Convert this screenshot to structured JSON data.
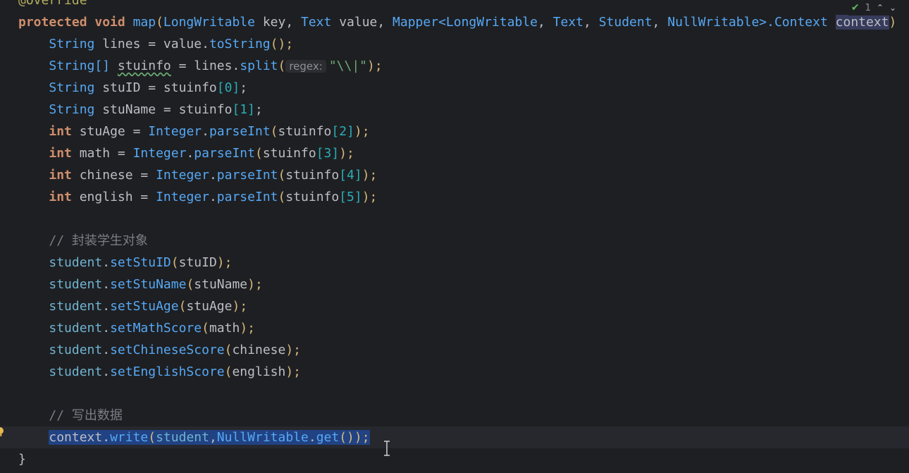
{
  "editor": {
    "status": {
      "problems_count": "1"
    },
    "lines": [
      [
        {
          "t": "@Override",
          "c": "ann"
        }
      ],
      [
        {
          "t": "protected ",
          "c": "kw"
        },
        {
          "t": "void ",
          "c": "kw"
        },
        {
          "t": "map",
          "c": "fn"
        },
        {
          "t": "(",
          "c": "paren"
        },
        {
          "t": "LongWritable ",
          "c": "type"
        },
        {
          "t": "key, ",
          "c": "punct"
        },
        {
          "t": "Text ",
          "c": "type"
        },
        {
          "t": "value, ",
          "c": "punct"
        },
        {
          "t": "Mapper<",
          "c": "type"
        },
        {
          "t": "LongWritable",
          "c": "type"
        },
        {
          "t": ", ",
          "c": "punct"
        },
        {
          "t": "Text",
          "c": "type"
        },
        {
          "t": ", ",
          "c": "punct"
        },
        {
          "t": "Student",
          "c": "type"
        },
        {
          "t": ", ",
          "c": "punct"
        },
        {
          "t": "NullWritable",
          "c": "type"
        },
        {
          "t": ">.Context ",
          "c": "type"
        },
        {
          "t": "context",
          "c": "punct ctxbox"
        },
        {
          "t": ")",
          "c": "paren"
        }
      ],
      [
        {
          "t": "    "
        },
        {
          "t": "String ",
          "c": "type"
        },
        {
          "t": "lines = value.",
          "c": "punct"
        },
        {
          "t": "toString",
          "c": "fn"
        },
        {
          "t": "();",
          "c": "paren"
        }
      ],
      [
        {
          "t": "    "
        },
        {
          "t": "String[] ",
          "c": "type"
        },
        {
          "t": "stuinfo",
          "c": "punct squiggle"
        },
        {
          "t": " = lines.",
          "c": "punct"
        },
        {
          "t": "split",
          "c": "fn"
        },
        {
          "t": "(",
          "c": "paren"
        },
        {
          "t": "regex:",
          "c": "hint"
        },
        {
          "t": "\"\\\\|\"",
          "c": "str"
        },
        {
          "t": ");",
          "c": "paren"
        }
      ],
      [
        {
          "t": "    "
        },
        {
          "t": "String ",
          "c": "type"
        },
        {
          "t": "stuID = stuinfo",
          "c": "punct"
        },
        {
          "t": "[0]",
          "c": "num"
        },
        {
          "t": ";",
          "c": "punct"
        }
      ],
      [
        {
          "t": "    "
        },
        {
          "t": "String ",
          "c": "type"
        },
        {
          "t": "stuName = stuinfo",
          "c": "punct"
        },
        {
          "t": "[1]",
          "c": "num"
        },
        {
          "t": ";",
          "c": "punct"
        }
      ],
      [
        {
          "t": "    "
        },
        {
          "t": "int ",
          "c": "kw"
        },
        {
          "t": "stuAge = ",
          "c": "punct"
        },
        {
          "t": "Integer",
          "c": "type"
        },
        {
          "t": ".",
          "c": "punct"
        },
        {
          "t": "parseInt",
          "c": "fn"
        },
        {
          "t": "(",
          "c": "paren"
        },
        {
          "t": "stuinfo",
          "c": "punct"
        },
        {
          "t": "[2]",
          "c": "num"
        },
        {
          "t": ");",
          "c": "paren"
        }
      ],
      [
        {
          "t": "    "
        },
        {
          "t": "int ",
          "c": "kw"
        },
        {
          "t": "math = ",
          "c": "punct"
        },
        {
          "t": "Integer",
          "c": "type"
        },
        {
          "t": ".",
          "c": "punct"
        },
        {
          "t": "parseInt",
          "c": "fn"
        },
        {
          "t": "(",
          "c": "paren"
        },
        {
          "t": "stuinfo",
          "c": "punct"
        },
        {
          "t": "[3]",
          "c": "num"
        },
        {
          "t": ");",
          "c": "paren"
        }
      ],
      [
        {
          "t": "    "
        },
        {
          "t": "int ",
          "c": "kw"
        },
        {
          "t": "chinese = ",
          "c": "punct"
        },
        {
          "t": "Integer",
          "c": "type"
        },
        {
          "t": ".",
          "c": "punct"
        },
        {
          "t": "parseInt",
          "c": "fn"
        },
        {
          "t": "(",
          "c": "paren"
        },
        {
          "t": "stuinfo",
          "c": "punct"
        },
        {
          "t": "[4]",
          "c": "num"
        },
        {
          "t": ");",
          "c": "paren"
        }
      ],
      [
        {
          "t": "    "
        },
        {
          "t": "int ",
          "c": "kw"
        },
        {
          "t": "english = ",
          "c": "punct"
        },
        {
          "t": "Integer",
          "c": "type"
        },
        {
          "t": ".",
          "c": "punct"
        },
        {
          "t": "parseInt",
          "c": "fn"
        },
        {
          "t": "(",
          "c": "paren"
        },
        {
          "t": "stuinfo",
          "c": "punct"
        },
        {
          "t": "[5]",
          "c": "num"
        },
        {
          "t": ");",
          "c": "paren"
        }
      ],
      [],
      [
        {
          "t": "    "
        },
        {
          "t": "// 封装学生对象",
          "c": "cm"
        }
      ],
      [
        {
          "t": "    "
        },
        {
          "t": "student",
          "c": "var"
        },
        {
          "t": ".",
          "c": "punct"
        },
        {
          "t": "setStuID",
          "c": "fn"
        },
        {
          "t": "(",
          "c": "paren"
        },
        {
          "t": "stuID",
          "c": "punct"
        },
        {
          "t": ");",
          "c": "paren"
        }
      ],
      [
        {
          "t": "    "
        },
        {
          "t": "student",
          "c": "var"
        },
        {
          "t": ".",
          "c": "punct"
        },
        {
          "t": "setStuName",
          "c": "fn"
        },
        {
          "t": "(",
          "c": "paren"
        },
        {
          "t": "stuName",
          "c": "punct"
        },
        {
          "t": ");",
          "c": "paren"
        }
      ],
      [
        {
          "t": "    "
        },
        {
          "t": "student",
          "c": "var"
        },
        {
          "t": ".",
          "c": "punct"
        },
        {
          "t": "setStuAge",
          "c": "fn"
        },
        {
          "t": "(",
          "c": "paren"
        },
        {
          "t": "stuAge",
          "c": "punct"
        },
        {
          "t": ");",
          "c": "paren"
        }
      ],
      [
        {
          "t": "    "
        },
        {
          "t": "student",
          "c": "var"
        },
        {
          "t": ".",
          "c": "punct"
        },
        {
          "t": "setMathScore",
          "c": "fn"
        },
        {
          "t": "(",
          "c": "paren"
        },
        {
          "t": "math",
          "c": "punct"
        },
        {
          "t": ");",
          "c": "paren"
        }
      ],
      [
        {
          "t": "    "
        },
        {
          "t": "student",
          "c": "var"
        },
        {
          "t": ".",
          "c": "punct"
        },
        {
          "t": "setChineseScore",
          "c": "fn"
        },
        {
          "t": "(",
          "c": "paren"
        },
        {
          "t": "chinese",
          "c": "punct"
        },
        {
          "t": ");",
          "c": "paren"
        }
      ],
      [
        {
          "t": "    "
        },
        {
          "t": "student",
          "c": "var"
        },
        {
          "t": ".",
          "c": "punct"
        },
        {
          "t": "setEnglishScore",
          "c": "fn"
        },
        {
          "t": "(",
          "c": "paren"
        },
        {
          "t": "english",
          "c": "punct"
        },
        {
          "t": ");",
          "c": "paren"
        }
      ],
      [],
      [
        {
          "t": "    "
        },
        {
          "t": "// 写出数据",
          "c": "cm"
        }
      ],
      [
        {
          "t": "    "
        },
        {
          "t": "context",
          "c": "punct sel"
        },
        {
          "t": ".",
          "c": "punct sel"
        },
        {
          "t": "write",
          "c": "fn sel"
        },
        {
          "t": "(",
          "c": "paren sel"
        },
        {
          "t": "student",
          "c": "var sel"
        },
        {
          "t": ",",
          "c": "punct sel"
        },
        {
          "t": "NullWritable",
          "c": "type sel"
        },
        {
          "t": ".",
          "c": "punct sel"
        },
        {
          "t": "get",
          "c": "fn sel"
        },
        {
          "t": "()",
          "c": "paren sel"
        },
        {
          "t": ");",
          "c": "paren sel"
        }
      ],
      [
        {
          "t": "}",
          "c": "punct"
        }
      ]
    ]
  }
}
